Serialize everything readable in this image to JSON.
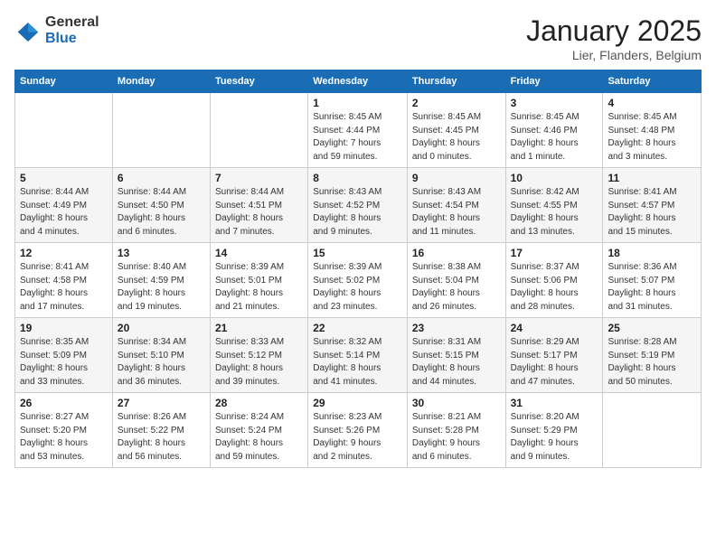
{
  "header": {
    "logo_general": "General",
    "logo_blue": "Blue",
    "title": "January 2025",
    "location": "Lier, Flanders, Belgium"
  },
  "weekdays": [
    "Sunday",
    "Monday",
    "Tuesday",
    "Wednesday",
    "Thursday",
    "Friday",
    "Saturday"
  ],
  "weeks": [
    [
      {
        "day": "",
        "info": ""
      },
      {
        "day": "",
        "info": ""
      },
      {
        "day": "",
        "info": ""
      },
      {
        "day": "1",
        "info": "Sunrise: 8:45 AM\nSunset: 4:44 PM\nDaylight: 7 hours\nand 59 minutes."
      },
      {
        "day": "2",
        "info": "Sunrise: 8:45 AM\nSunset: 4:45 PM\nDaylight: 8 hours\nand 0 minutes."
      },
      {
        "day": "3",
        "info": "Sunrise: 8:45 AM\nSunset: 4:46 PM\nDaylight: 8 hours\nand 1 minute."
      },
      {
        "day": "4",
        "info": "Sunrise: 8:45 AM\nSunset: 4:48 PM\nDaylight: 8 hours\nand 3 minutes."
      }
    ],
    [
      {
        "day": "5",
        "info": "Sunrise: 8:44 AM\nSunset: 4:49 PM\nDaylight: 8 hours\nand 4 minutes."
      },
      {
        "day": "6",
        "info": "Sunrise: 8:44 AM\nSunset: 4:50 PM\nDaylight: 8 hours\nand 6 minutes."
      },
      {
        "day": "7",
        "info": "Sunrise: 8:44 AM\nSunset: 4:51 PM\nDaylight: 8 hours\nand 7 minutes."
      },
      {
        "day": "8",
        "info": "Sunrise: 8:43 AM\nSunset: 4:52 PM\nDaylight: 8 hours\nand 9 minutes."
      },
      {
        "day": "9",
        "info": "Sunrise: 8:43 AM\nSunset: 4:54 PM\nDaylight: 8 hours\nand 11 minutes."
      },
      {
        "day": "10",
        "info": "Sunrise: 8:42 AM\nSunset: 4:55 PM\nDaylight: 8 hours\nand 13 minutes."
      },
      {
        "day": "11",
        "info": "Sunrise: 8:41 AM\nSunset: 4:57 PM\nDaylight: 8 hours\nand 15 minutes."
      }
    ],
    [
      {
        "day": "12",
        "info": "Sunrise: 8:41 AM\nSunset: 4:58 PM\nDaylight: 8 hours\nand 17 minutes."
      },
      {
        "day": "13",
        "info": "Sunrise: 8:40 AM\nSunset: 4:59 PM\nDaylight: 8 hours\nand 19 minutes."
      },
      {
        "day": "14",
        "info": "Sunrise: 8:39 AM\nSunset: 5:01 PM\nDaylight: 8 hours\nand 21 minutes."
      },
      {
        "day": "15",
        "info": "Sunrise: 8:39 AM\nSunset: 5:02 PM\nDaylight: 8 hours\nand 23 minutes."
      },
      {
        "day": "16",
        "info": "Sunrise: 8:38 AM\nSunset: 5:04 PM\nDaylight: 8 hours\nand 26 minutes."
      },
      {
        "day": "17",
        "info": "Sunrise: 8:37 AM\nSunset: 5:06 PM\nDaylight: 8 hours\nand 28 minutes."
      },
      {
        "day": "18",
        "info": "Sunrise: 8:36 AM\nSunset: 5:07 PM\nDaylight: 8 hours\nand 31 minutes."
      }
    ],
    [
      {
        "day": "19",
        "info": "Sunrise: 8:35 AM\nSunset: 5:09 PM\nDaylight: 8 hours\nand 33 minutes."
      },
      {
        "day": "20",
        "info": "Sunrise: 8:34 AM\nSunset: 5:10 PM\nDaylight: 8 hours\nand 36 minutes."
      },
      {
        "day": "21",
        "info": "Sunrise: 8:33 AM\nSunset: 5:12 PM\nDaylight: 8 hours\nand 39 minutes."
      },
      {
        "day": "22",
        "info": "Sunrise: 8:32 AM\nSunset: 5:14 PM\nDaylight: 8 hours\nand 41 minutes."
      },
      {
        "day": "23",
        "info": "Sunrise: 8:31 AM\nSunset: 5:15 PM\nDaylight: 8 hours\nand 44 minutes."
      },
      {
        "day": "24",
        "info": "Sunrise: 8:29 AM\nSunset: 5:17 PM\nDaylight: 8 hours\nand 47 minutes."
      },
      {
        "day": "25",
        "info": "Sunrise: 8:28 AM\nSunset: 5:19 PM\nDaylight: 8 hours\nand 50 minutes."
      }
    ],
    [
      {
        "day": "26",
        "info": "Sunrise: 8:27 AM\nSunset: 5:20 PM\nDaylight: 8 hours\nand 53 minutes."
      },
      {
        "day": "27",
        "info": "Sunrise: 8:26 AM\nSunset: 5:22 PM\nDaylight: 8 hours\nand 56 minutes."
      },
      {
        "day": "28",
        "info": "Sunrise: 8:24 AM\nSunset: 5:24 PM\nDaylight: 8 hours\nand 59 minutes."
      },
      {
        "day": "29",
        "info": "Sunrise: 8:23 AM\nSunset: 5:26 PM\nDaylight: 9 hours\nand 2 minutes."
      },
      {
        "day": "30",
        "info": "Sunrise: 8:21 AM\nSunset: 5:28 PM\nDaylight: 9 hours\nand 6 minutes."
      },
      {
        "day": "31",
        "info": "Sunrise: 8:20 AM\nSunset: 5:29 PM\nDaylight: 9 hours\nand 9 minutes."
      },
      {
        "day": "",
        "info": ""
      }
    ]
  ]
}
